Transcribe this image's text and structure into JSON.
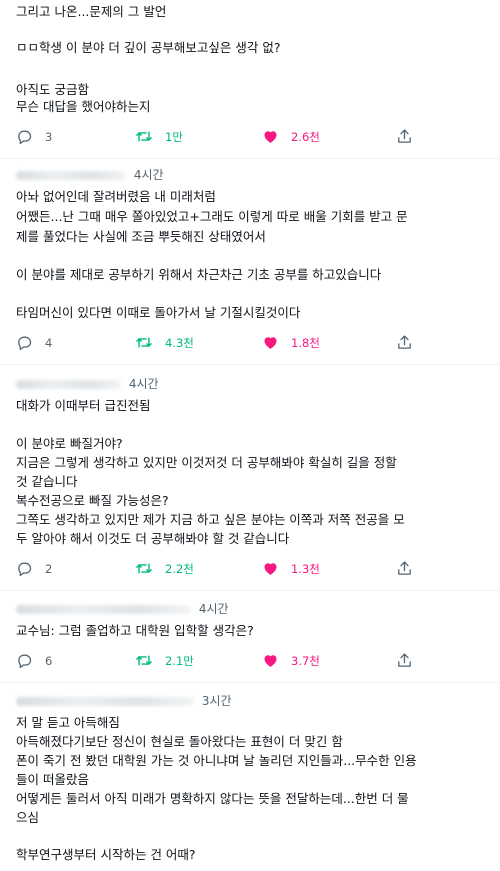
{
  "tweets": [
    {
      "handle": "",
      "time": "",
      "lines": [
        "그리고 나온...문제의 그  발언",
        "",
        "ㅁㅁ학생 이 분야 더 깊이 공부해보고싶은 생각 없?",
        "",
        "아직도 궁금함",
        "무슨 대답을 했어야하는지"
      ],
      "replies": "3",
      "retweets": "1만",
      "likes": "2.6천"
    },
    {
      "handle": "",
      "time": "4시간",
      "lines": [
        "아놔 없어인데 잘려버렸음 내 미래처럼",
        "어쨌든...난 그때 매우 쫄아있었고+그래도 이렇게 따로 배울 기회를 받고 문",
        "제를 풀었다는 사실에 조금 뿌듯해진 상태였어서",
        "",
        "이 분야를 제대로 공부하기 위해서 차근차근 기초 공부를 하고있습니다",
        "",
        "타임머신이 있다면 이때로 돌아가서 날 기절시킬것이다"
      ],
      "replies": "4",
      "retweets": "4.3천",
      "likes": "1.8천"
    },
    {
      "handle": "",
      "time": "4시간",
      "lines": [
        "대화가 이때부터 급진전됨",
        "",
        "이 분야로 빠질거야?",
        "지금은 그렇게 생각하고 있지만 이것저것 더 공부해봐야 확실히 길을 정할",
        "것 같습니다",
        "복수전공으로 빠질 가능성은?",
        "그쪽도 생각하고 있지만 제가 지금 하고 싶은 분야는 이쪽과 저쪽 전공을 모",
        "두 알아야 해서 이것도 더 공부해봐야 할 것 같습니다"
      ],
      "replies": "2",
      "retweets": "2.2천",
      "likes": "1.3천"
    },
    {
      "handle": "",
      "time": "4시간",
      "lines": [
        "교수님: 그럼 졸업하고 대학원 입학할 생각은?"
      ],
      "replies": "6",
      "retweets": "2.1만",
      "likes": "3.7천"
    },
    {
      "handle": "",
      "time": "3시간",
      "lines": [
        "저 말 듣고 아득해짐",
        "아득해졌다기보단 정신이 현실로 돌아왔다는 표현이 더 맞긴 함",
        "폰이 죽기 전 봤던 대학원 가는 것 아니냐며 날 놀리던 지인들과...무수한 인용",
        "들이 떠올랐음",
        "어떻게든 둘러서 아직 미래가 명확하지 않다는 뜻을 전달하는데...한번 더 물",
        "으심",
        "",
        "학부연구생부터 시작하는 건 어때?"
      ]
    }
  ],
  "colors": {
    "text": "#0f1419",
    "muted": "#536471",
    "retweet": "#00ba7c",
    "like": "#f91880",
    "separator": "#eff3f4"
  },
  "icons": [
    "reply-icon",
    "retweet-icon",
    "heart-icon",
    "share-icon"
  ]
}
